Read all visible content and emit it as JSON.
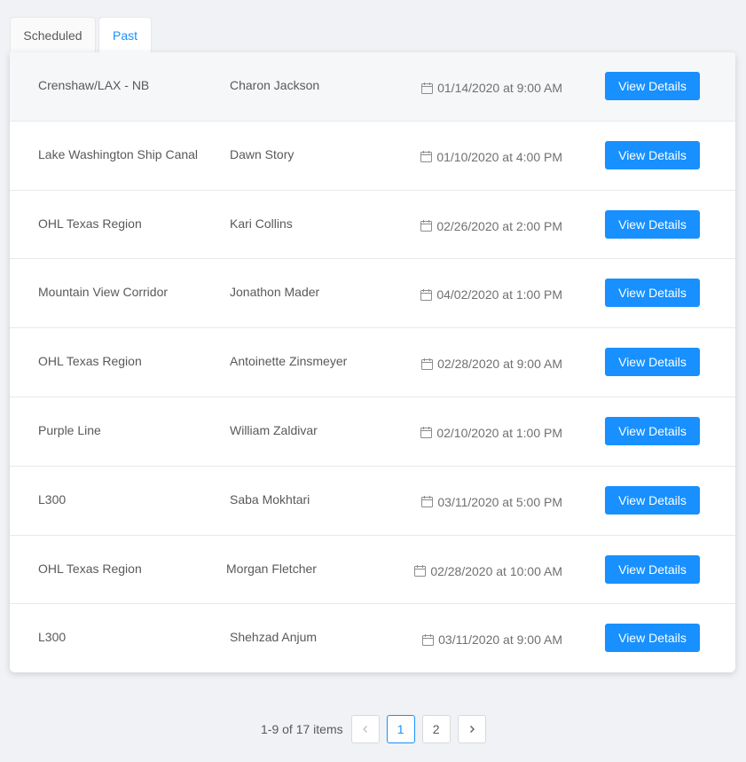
{
  "tabs": [
    {
      "label": "Scheduled"
    },
    {
      "label": "Past"
    }
  ],
  "rows": [
    {
      "location": "Crenshaw/LAX - NB",
      "person": "Charon Jackson",
      "datetime": "01/14/2020 at 9:00 AM",
      "action": "View Details"
    },
    {
      "location": "Lake Washington Ship Canal",
      "person": "Dawn Story",
      "datetime": "01/10/2020 at 4:00 PM",
      "action": "View Details"
    },
    {
      "location": "OHL Texas Region",
      "person": "Kari Collins",
      "datetime": "02/26/2020 at 2:00 PM",
      "action": "View Details"
    },
    {
      "location": "Mountain View Corridor",
      "person": "Jonathon Mader",
      "datetime": "04/02/2020 at 1:00 PM",
      "action": "View Details"
    },
    {
      "location": "OHL Texas Region",
      "person": "Antoinette Zinsmeyer",
      "datetime": "02/28/2020 at 9:00 AM",
      "action": "View Details"
    },
    {
      "location": "Purple Line",
      "person": "William Zaldivar",
      "datetime": "02/10/2020 at 1:00 PM",
      "action": "View Details"
    },
    {
      "location": "L300",
      "person": "Saba Mokhtari",
      "datetime": "03/11/2020 at 5:00 PM",
      "action": "View Details"
    },
    {
      "location": "OHL Texas Region",
      "person": "Morgan Fletcher",
      "datetime": "02/28/2020 at 10:00 AM",
      "action": "View Details"
    },
    {
      "location": "L300",
      "person": "Shehzad Anjum",
      "datetime": "03/11/2020 at 9:00 AM",
      "action": "View Details"
    }
  ],
  "pagination": {
    "total_text": "1-9 of 17 items",
    "prev_icon": "chevron-left-icon",
    "pages": [
      "1",
      "2"
    ],
    "current": "1",
    "next_icon": "chevron-right-icon"
  },
  "colors": {
    "accent": "#1890ff",
    "background": "#f0f2f5"
  }
}
